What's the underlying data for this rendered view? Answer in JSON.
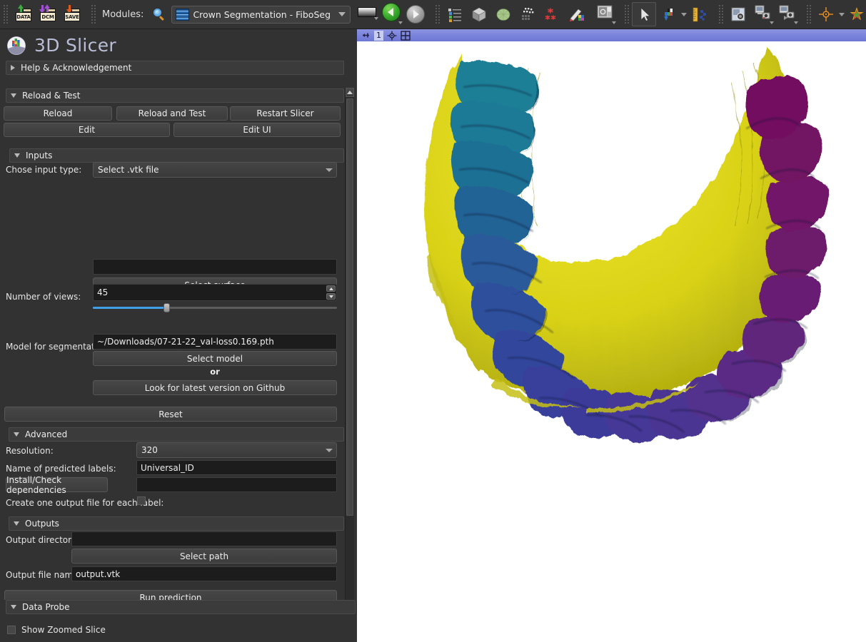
{
  "toolbar": {
    "groups": [
      {
        "name": "io-group",
        "items": [
          {
            "icon": "data-folder-icon",
            "label": "DATA",
            "arrow_color": "#3fa83f"
          },
          {
            "icon": "dicom-folder-icon",
            "label": "DCM",
            "arrow_color": "#a34fd6"
          },
          {
            "icon": "save-folder-icon",
            "label": "SAVE",
            "arrow_color": "#e05a1a"
          }
        ]
      }
    ],
    "modules_label": "Modules:",
    "search_icon": "search-icon",
    "module_selector": {
      "value": "Crown Segmentation - FiboSeg",
      "icon": "module-icon",
      "caret": "chevron-down-icon"
    },
    "lut_icon": "color-table-icon",
    "back_icon": "back-arrow-icon",
    "forward_icon": "forward-arrow-icon",
    "right_icons": [
      {
        "name": "subject-hierarchy-icon"
      },
      {
        "name": "volume-rendering-icon"
      },
      {
        "name": "models-icon"
      },
      {
        "name": "transforms-icon"
      },
      {
        "name": "markups-icon"
      },
      {
        "name": "segment-editor-icon"
      },
      {
        "name": "layout-icon"
      },
      {
        "name": "mouse-pointer-icon"
      },
      {
        "name": "window-level-icon"
      },
      {
        "name": "ruler-icon"
      },
      {
        "name": "screenshot-icon"
      },
      {
        "name": "scene-view-capture-icon"
      },
      {
        "name": "scene-view-restore-icon"
      },
      {
        "name": "crosshair-icon"
      },
      {
        "name": "markups-star-icon"
      },
      {
        "name": "extension-manager-icon"
      },
      {
        "name": "python-console-icon"
      }
    ]
  },
  "panel": {
    "app_title": "3D Slicer",
    "logo": "slicer-logo-icon",
    "help_section": {
      "title": "Help & Acknowledgement",
      "expanded": false
    },
    "reload_section": {
      "title": "Reload & Test",
      "expanded": true,
      "buttons_row1": [
        "Reload",
        "Reload and Test",
        "Restart Slicer"
      ],
      "buttons_row2": [
        "Edit",
        "Edit UI"
      ]
    },
    "inputs_section": {
      "title": "Inputs",
      "expanded": true,
      "input_type_label": "Chose input type:",
      "input_type_value": "Select .vtk file",
      "surface_path_value": "",
      "select_surface_button": "Select surface",
      "views_label": "Number of views:",
      "views_value": "45",
      "views_slider_percent": 30,
      "model_label": "Model for segmentation:",
      "model_value": "~/Downloads/07-21-22_val-loss0.169.pth",
      "select_model_button": "Select model",
      "or_text": "or",
      "github_button": "Look for latest version on Github",
      "reset_button": "Reset"
    },
    "advanced_section": {
      "title": "Advanced",
      "expanded": true,
      "resolution_label": "Resolution:",
      "resolution_value": "320",
      "labels_name_label": "Name of predicted labels:",
      "labels_name_value": "Universal_ID",
      "dependencies_button": "Install/Check dependencies",
      "dependencies_status_value": "",
      "one_file_label": "Create one output file for each label:",
      "one_file_checked": false
    },
    "outputs_section": {
      "title": "Outputs",
      "expanded": true,
      "output_dir_label": "Output directory:",
      "output_dir_value": "",
      "select_path_button": "Select path",
      "output_file_label": "Output file name:",
      "output_file_value": "output.vtk",
      "run_button": "Run prediction",
      "progress_value": ""
    },
    "data_probe_section": {
      "title": "Data Probe",
      "expanded": true
    },
    "show_zoomed_slice_label": "Show Zoomed Slice",
    "show_zoomed_slice_checked": false,
    "scrollbar": {
      "up_icon": "scroll-up-icon",
      "down_icon": "scroll-down-icon"
    }
  },
  "view": {
    "pin_icon": "pin-icon",
    "view_number": "1",
    "center_icon": "center-view-icon",
    "layout_icon": "grid-layout-icon",
    "scene": {
      "description": "3D rendering of a segmented mandibular dental arch",
      "background_color": "#ffffff",
      "gum_color": "#d8d117",
      "tooth_colors": [
        "#1f7f96",
        "#1d7392",
        "#236896",
        "#2a5b9a",
        "#2e4f9c",
        "#33459b",
        "#3b3e9b",
        "#453a9b",
        "#4c3597",
        "#55308f",
        "#5c2b86",
        "#64237c",
        "#6b1b71",
        "#701566"
      ]
    }
  }
}
